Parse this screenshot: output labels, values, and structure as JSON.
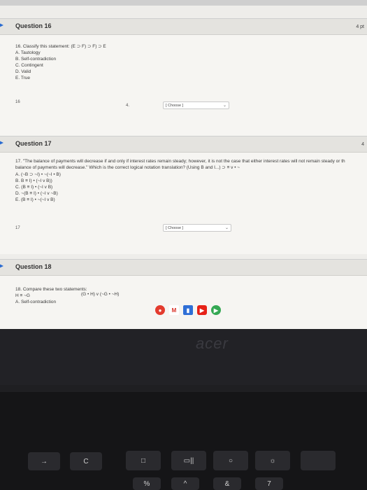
{
  "topbar": {
    "text": ""
  },
  "q16": {
    "header": "Question 16",
    "points": "4 pt",
    "prompt": "16. Classify this statement: (E ⊃ F) ⊃ F) ⊃ E",
    "options": [
      "A. Tautology",
      "B. Self-contradiction",
      "C. Contingent",
      "D. Valid",
      "E. True"
    ],
    "item_number": "16",
    "item_symbol": "4.",
    "select_value": "[ Choose ]"
  },
  "q17": {
    "header": "Question 17",
    "points": "4",
    "prompt_line1": "17. \"The balance of payments will decrease if and only if interest rates remain steady; however, it is not the case that either interest rates will not remain steady or th",
    "prompt_line2": "balance of payments will decrease.\" Which is the correct logical notation translation? (Using B and I...) ⊃ ≡ v • ~",
    "options": [
      "A. (~B ⊃ ~I) • ~(~I • B)",
      "B. B ≡ I) • (~I v B))",
      "C. (B ≡ I) • (~I v B)",
      "D. ~(B ≡ I) • (~I v ~B)",
      "E. (B ≡ I) • ~(~I v B)"
    ],
    "item_number": "17",
    "select_value": "[ Choose ]"
  },
  "q18": {
    "header": "Question 18",
    "prompt": "18. Compare these two statements:",
    "statement_left": "H ≡ ~G",
    "statement_right": "(G • H) v (~G • ~H)",
    "option_a": "A. Self-contradiction"
  },
  "brand": "acer",
  "keyboard": {
    "k_arrow": "→",
    "k_refresh": "C",
    "k_fullscreen": "□",
    "k_overview": "▭||",
    "k_dim": "○",
    "k_bright": "☼",
    "k_7": "7",
    "k_amp": "&",
    "k_pct": "%",
    "k_caret": "^"
  },
  "colors": {
    "chrome": "#e33b2e",
    "gmail": "#ffffff",
    "files": "#2f6fd6",
    "youtube": "#e62117",
    "play": "#34a853"
  }
}
